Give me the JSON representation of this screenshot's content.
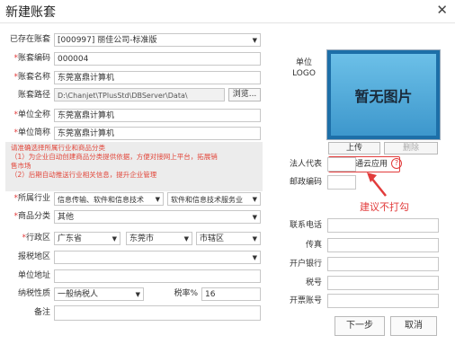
{
  "dialog": {
    "title": "新建账套",
    "close_glyph": "✕"
  },
  "form": {
    "existing": {
      "label": "已存在账套",
      "value": "[000997] 丽佳公司-标准版"
    },
    "code": {
      "label": "账套编码",
      "value": "000004"
    },
    "name": {
      "label": "账套名称",
      "value": "东莞富鼎计算机"
    },
    "path": {
      "label": "账套路径",
      "value": "D:\\Chanjet\\TPlusStd\\DBServer\\Data\\",
      "browse": "浏览..."
    },
    "fullname": {
      "label": "单位全称",
      "value": "东莞富鼎计算机"
    },
    "shortname": {
      "label": "单位简称",
      "value": "东莞富鼎计算机"
    },
    "notice": [
      "请准确选择所属行业和商品分类",
      "（1）为企业自动创建商品分类提供依据，方便对接网上平台，拓展销",
      "售市场",
      "（2）后期自动推送行业相关信息，提升企业管理"
    ],
    "industry": {
      "label": "所属行业",
      "value1": "信息传输、软件和信息技术",
      "value2": "软件和信息技术服务业"
    },
    "category": {
      "label": "商品分类",
      "value": "其他"
    },
    "region": {
      "label": "行政区",
      "province": "广东省",
      "city": "东莞市",
      "district": "市辖区"
    },
    "tax_region": {
      "label": "报税地区",
      "value": ""
    },
    "address": {
      "label": "单位地址",
      "value": ""
    },
    "taxpayer": {
      "label": "纳税性质",
      "value": "一般纳税人",
      "rate_label": "税率%",
      "rate": "16"
    },
    "remark": {
      "label": "备注",
      "value": ""
    }
  },
  "logo": {
    "label1": "单位",
    "label2": "LOGO",
    "placeholder": "暂无图片",
    "upload": "上传",
    "delete": "删除"
  },
  "cloud": {
    "label": "开通云应用",
    "help": "?"
  },
  "annotation": {
    "text": "建议不打勾",
    "color": "#e23b3b"
  },
  "right_fields": [
    {
      "label": "法人代表"
    },
    {
      "label": "邮政编码"
    },
    {
      "label": "联系电话"
    },
    {
      "label": "传真"
    },
    {
      "label": "开户银行"
    },
    {
      "label": "税号"
    },
    {
      "label": "开票账号"
    }
  ],
  "buttons": {
    "next": "下一步",
    "cancel": "取消"
  }
}
